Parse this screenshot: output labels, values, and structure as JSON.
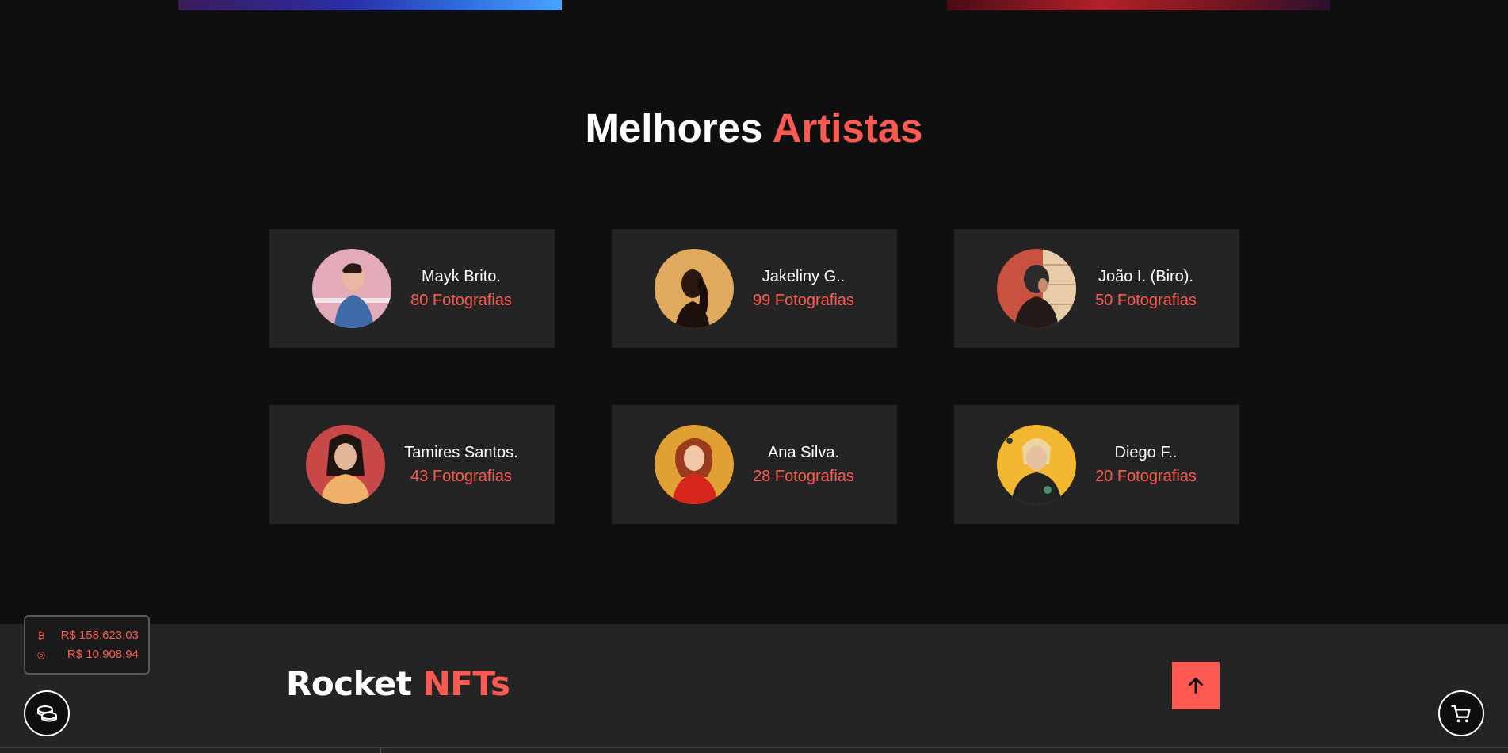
{
  "section": {
    "title_main": "Melhores",
    "title_accent": "Artistas"
  },
  "artists": [
    {
      "name": "Mayk Brito.",
      "photos": "80 Fotografias",
      "avatar_bg": "#e0a6b4"
    },
    {
      "name": "Jakeliny G..",
      "photos": "99 Fotografias",
      "avatar_bg": "#d9a55b"
    },
    {
      "name": "João I. (Biro).",
      "photos": "50 Fotografias",
      "avatar_bg": "#c9513f"
    },
    {
      "name": "Tamires Santos.",
      "photos": "43 Fotografias",
      "avatar_bg": "#c84a4a"
    },
    {
      "name": "Ana Silva.",
      "photos": "28 Fotografias",
      "avatar_bg": "#e3a233"
    },
    {
      "name": "Diego F..",
      "photos": "20 Fotografias",
      "avatar_bg": "#f3b633"
    }
  ],
  "footer": {
    "brand_main": "Rocket",
    "brand_accent": "NFTs"
  },
  "prices": {
    "btc_icon": "₿",
    "btc_value": "R$ 158.623,03",
    "eth_icon": "◎",
    "eth_value": "R$ 10.908,94"
  },
  "colors": {
    "accent": "#ff5a52",
    "card_bg": "#242424",
    "page_bg": "#0f0f0f"
  },
  "icons": {
    "to_top": "arrow-up-icon",
    "coins": "coins-icon",
    "cart": "cart-icon"
  }
}
